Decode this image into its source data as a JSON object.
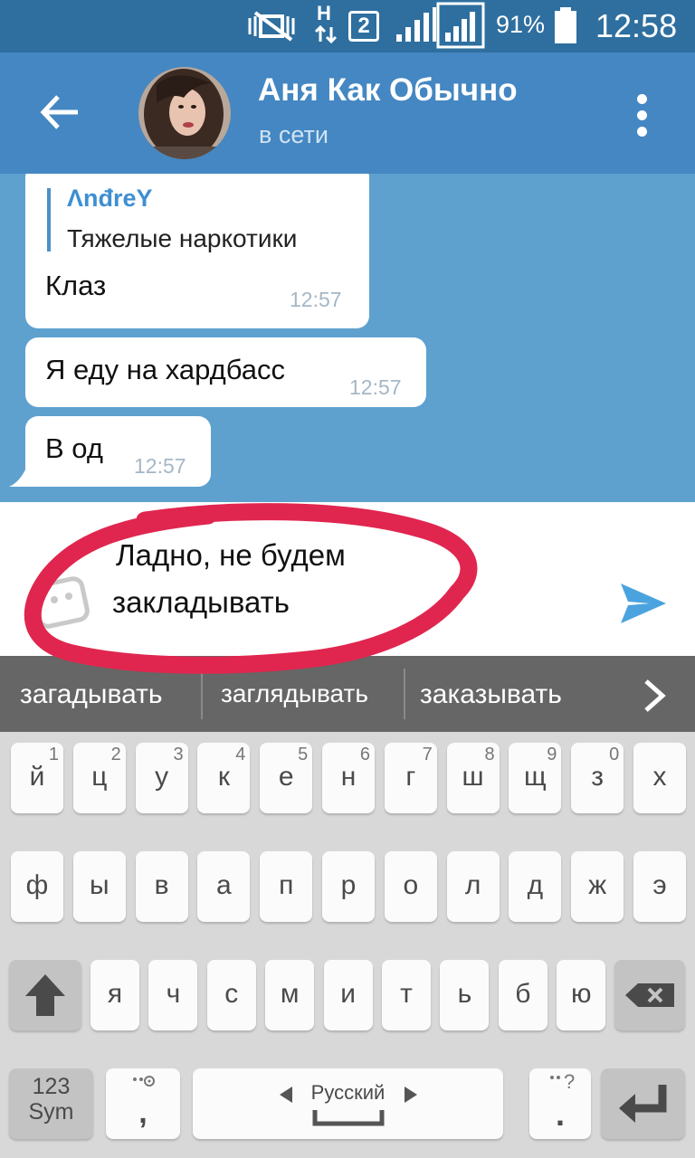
{
  "status_bar": {
    "sim_number": "2",
    "network_type": "H",
    "battery": "91%",
    "time": "12:58"
  },
  "header": {
    "title": "Аня Как Обычно",
    "status": "в сети"
  },
  "messages": [
    {
      "reply_author": "ΛnđreY",
      "reply_text": "Тяжелые наркотики",
      "text": "Клаз",
      "time": "12:57"
    },
    {
      "text": "Я еду на хардбасс",
      "time": "12:57"
    },
    {
      "text": "В од",
      "time": "12:57"
    }
  ],
  "input": {
    "line1": "Ладно, не будем",
    "line2": "закладывать"
  },
  "suggestions": [
    "загадывать",
    "заглядывать",
    "заказывать"
  ],
  "keyboard": {
    "row1": [
      {
        "l": "й",
        "n": "1"
      },
      {
        "l": "ц",
        "n": "2"
      },
      {
        "l": "у",
        "n": "3"
      },
      {
        "l": "к",
        "n": "4"
      },
      {
        "l": "е",
        "n": "5"
      },
      {
        "l": "н",
        "n": "6"
      },
      {
        "l": "г",
        "n": "7"
      },
      {
        "l": "ш",
        "n": "8"
      },
      {
        "l": "щ",
        "n": "9"
      },
      {
        "l": "з",
        "n": "0"
      },
      {
        "l": "х",
        "n": ""
      }
    ],
    "row2": [
      "ф",
      "ы",
      "в",
      "а",
      "п",
      "р",
      "о",
      "л",
      "д",
      "ж",
      "э"
    ],
    "row3": [
      "я",
      "ч",
      "с",
      "м",
      "и",
      "т",
      "ь",
      "б",
      "ю"
    ],
    "sym_label_1": "123",
    "sym_label_2": "Sym",
    "comma": ",",
    "period": ".",
    "space_label": "Русский",
    "question_mark": "?"
  },
  "colors": {
    "header": "#4487c2",
    "status_bar": "#2e6f9f",
    "chat_background": "#5ea1cf",
    "annotation_circle": "#e0264f",
    "send_icon": "#4aa3df"
  }
}
